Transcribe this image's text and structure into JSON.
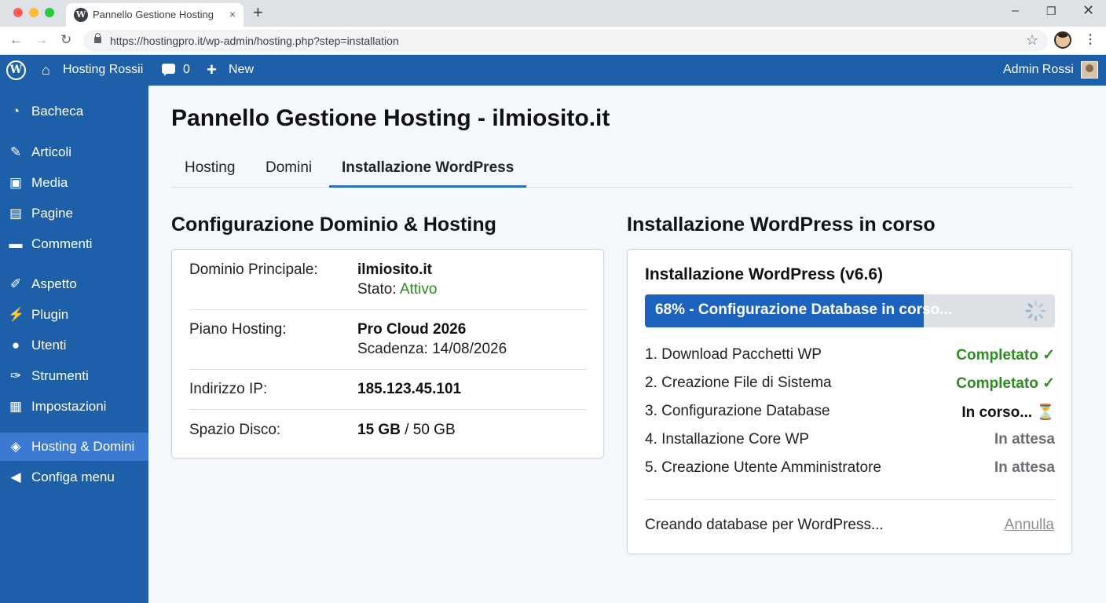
{
  "browser": {
    "tab_title": "Pannello Gestione Hosting - il",
    "tab_close": "×",
    "new_tab": "+",
    "url": "https://hostingpro.it/wp-admin/hosting.php?step=installation",
    "window_controls": [
      "–",
      "❐",
      "✕"
    ]
  },
  "adminbar": {
    "site_name": "Hosting Rossii",
    "comments_count": "0",
    "new_label": "New",
    "user_name": "Admin Rossi"
  },
  "sidebar": {
    "items": [
      {
        "label": "Bacheca",
        "icon": "dashboard-icon"
      },
      {
        "label": "Articoli",
        "icon": "pin-icon"
      },
      {
        "label": "Media",
        "icon": "media-icon"
      },
      {
        "label": "Pagine",
        "icon": "pages-icon"
      },
      {
        "label": "Commenti",
        "icon": "comments-icon"
      },
      {
        "label": "Aspetto",
        "icon": "brush-icon"
      },
      {
        "label": "Plugin",
        "icon": "plugin-icon"
      },
      {
        "label": "Utenti",
        "icon": "user-icon"
      },
      {
        "label": "Strumenti",
        "icon": "wrench-icon"
      },
      {
        "label": "Impostazioni",
        "icon": "settings-icon"
      },
      {
        "label": "Hosting & Domini",
        "icon": "layers-icon",
        "active": true
      },
      {
        "label": "Configa menu",
        "icon": "collapse-icon"
      }
    ]
  },
  "main": {
    "page_title": "Pannello Gestione Hosting - ilmiosito.it",
    "tabs": [
      "Hosting",
      "Domini",
      "Installazione WordPress"
    ],
    "active_tab": "Installazione WordPress",
    "left": {
      "section_title": "Configurazione Dominio & Hosting",
      "rows": [
        {
          "label": "Dominio Principale:",
          "value": "ilmiosito.it",
          "sub_prefix": "Stato:",
          "sub_value": "Attivo"
        },
        {
          "label": "Piano Hosting:",
          "value": "Pro Cloud 2026",
          "sub": "Scadenza: 14/08/2026"
        },
        {
          "label": "Indirizzo IP:",
          "value": "185.123.45.101"
        },
        {
          "label": "Spazio Disco:",
          "value": "15 GB",
          "value_rest": " / 50 GB"
        }
      ]
    },
    "right": {
      "section_title": "Installazione WordPress in corso",
      "install_title": "Installazione WordPress (v6.6)",
      "progress": {
        "percent": 68,
        "text": "68% - Configurazione Database in corso..."
      },
      "steps": [
        {
          "label": "1. Download Pacchetti WP",
          "status": "Completato ✓",
          "state": "done"
        },
        {
          "label": "2. Creazione File di Sistema",
          "status": "Completato ✓",
          "state": "done"
        },
        {
          "label": "3. Configurazione Database",
          "status": "In corso... ⏳",
          "state": "progress"
        },
        {
          "label": "4. Installazione Core WP",
          "status": "In attesa",
          "state": "wait"
        },
        {
          "label": "5. Creazione Utente Amministratore",
          "status": "In attesa",
          "state": "wait"
        }
      ],
      "footer_text": "Creando database per WordPress...",
      "cancel_label": "Annulla"
    }
  },
  "colors": {
    "sidebar_bg": "#1e5faa",
    "sidebar_active": "#3b7ad0",
    "progress_fill": "#1c63c0",
    "success_green": "#2e8b23"
  }
}
